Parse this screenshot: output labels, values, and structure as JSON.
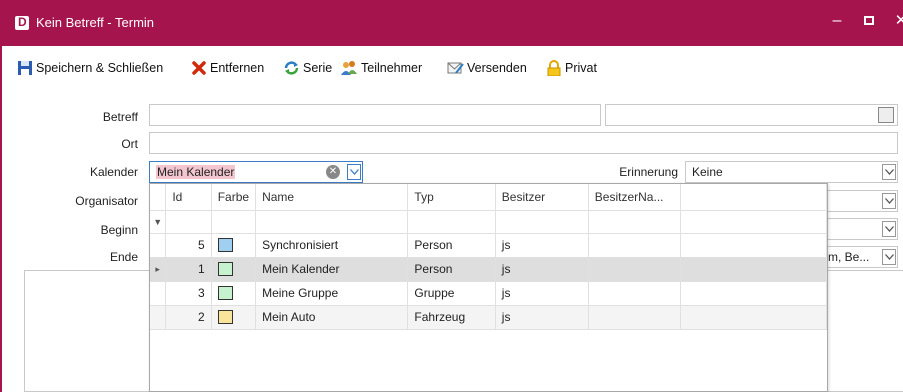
{
  "window": {
    "title": "Kein Betreff - Termin",
    "accent_color": "#a6144e",
    "controls": {
      "minimize": "–",
      "maximize": "",
      "close": "✕"
    }
  },
  "toolbar": {
    "items": [
      {
        "label": "Speichern & Schließen",
        "icon": "save-icon"
      },
      {
        "label": "Entfernen",
        "icon": "delete-icon"
      },
      {
        "label": "Serie",
        "icon": "recurrence-icon"
      },
      {
        "label": "Teilnehmer",
        "icon": "participants-icon"
      },
      {
        "label": "Versenden",
        "icon": "send-icon"
      },
      {
        "label": "Privat",
        "icon": "lock-icon"
      }
    ]
  },
  "form": {
    "betreff_label": "Betreff",
    "ort_label": "Ort",
    "kalender_label": "Kalender",
    "kalender_value": "Mein Kalender",
    "organisator_label": "Organisator",
    "beginn_label": "Beginn",
    "ende_label": "Ende",
    "erinnerung_label": "Erinnerung",
    "erinnerung_value": "Keine",
    "ende_right_value": "m, Be..."
  },
  "calendar_popup": {
    "columns": [
      "Id",
      "Farbe",
      "Name",
      "Typ",
      "Besitzer",
      "BesitzerNa..."
    ],
    "rows": [
      {
        "id": "5",
        "color": "#9fd0f0",
        "name": "Synchronisiert",
        "typ": "Person",
        "besitzer": "js",
        "selected": false
      },
      {
        "id": "1",
        "color": "#c6f2cf",
        "name": "Mein Kalender",
        "typ": "Person",
        "besitzer": "js",
        "selected": true
      },
      {
        "id": "3",
        "color": "#c6f2cf",
        "name": "Meine Gruppe",
        "typ": "Gruppe",
        "besitzer": "js",
        "selected": false
      },
      {
        "id": "2",
        "color": "#f8e59a",
        "name": "Mein Auto",
        "typ": "Fahrzeug",
        "besitzer": "js",
        "selected": false
      }
    ]
  }
}
